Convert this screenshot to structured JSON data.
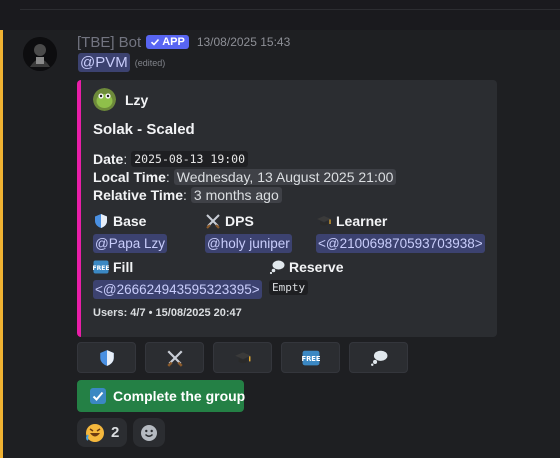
{
  "message": {
    "username": "[TBE] Bot",
    "app_tag": "APP",
    "timestamp": "13/08/2025 15:43",
    "mention": "@PVM",
    "edited": "(edited)"
  },
  "embed": {
    "author": "Lzy",
    "title": "Solak - Scaled",
    "fields": {
      "date_label": "Date",
      "date_value": "2025-08-13 19:00",
      "local_time_label": "Local Time",
      "local_time_value": "Wednesday, 13 August 2025 21:00",
      "relative_time_label": "Relative Time",
      "relative_time_value": "3 months ago"
    },
    "roles": {
      "base": {
        "title": "Base",
        "value": "@Papa Lzy"
      },
      "dps": {
        "title": "DPS",
        "value": "@holy juniper"
      },
      "learner": {
        "title": "Learner",
        "value": "<@210069870593703938>"
      },
      "fill": {
        "title": "Fill",
        "value": "<@266624943595323395>"
      },
      "reserve": {
        "title": "Reserve",
        "value": "Empty"
      }
    },
    "footer": "Users: 4/7 • 15/08/2025 20:47",
    "border_color": "#e91ea8"
  },
  "buttons": [
    {
      "icon": "shield-icon"
    },
    {
      "icon": "crossed-swords-icon"
    },
    {
      "icon": "graduation-cap-icon"
    },
    {
      "icon": "free-badge-icon"
    },
    {
      "icon": "thought-bubble-icon"
    }
  ],
  "complete_button": {
    "label": "Complete the group",
    "color": "#248045"
  },
  "reactions": [
    {
      "emoji": "rofl-icon",
      "count": "2"
    },
    {
      "emoji": "add-reaction-icon"
    }
  ]
}
